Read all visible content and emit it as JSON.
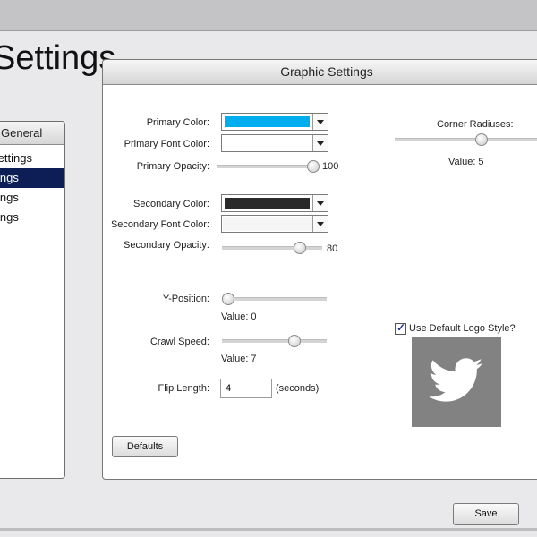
{
  "window": {
    "title": "Settings"
  },
  "sidebar": {
    "header": "General",
    "items": [
      {
        "label": "Settings"
      },
      {
        "label": "ings"
      },
      {
        "label": "ings"
      },
      {
        "label": "ings"
      }
    ]
  },
  "panel": {
    "title": "Graphic Settings",
    "primary_color": {
      "label": "Primary Color:",
      "value": "#00aef0"
    },
    "primary_font_color": {
      "label": "Primary Font Color:",
      "value": "#ffffff"
    },
    "primary_opacity": {
      "label": "Primary Opacity:",
      "value": "100",
      "fraction": 1.0
    },
    "secondary_color": {
      "label": "Secondary Color:",
      "value": "#2a2a2a"
    },
    "secondary_font_color": {
      "label": "Secondary Font Color:",
      "value": "#f5f5f5"
    },
    "secondary_opacity": {
      "label": "Secondary Opacity:",
      "value": "80",
      "fraction": 0.8
    },
    "y_position": {
      "label": "Y-Position:",
      "value_text": "Value:  0",
      "fraction": 0.0
    },
    "crawl_speed": {
      "label": "Crawl Speed:",
      "value_text": "Value:  7",
      "fraction": 0.7
    },
    "flip_length": {
      "label": "Flip Length:",
      "value": "4",
      "unit": "(seconds)"
    },
    "corner_radiuses": {
      "label": "Corner Radiuses:",
      "value_text": "Value: 5"
    },
    "use_default_logo": {
      "label": "Use Default Logo Style?",
      "checked": true
    },
    "logo_icon": "twitter-bird-icon",
    "defaults_button": "Defaults"
  },
  "footer": {
    "save_button": "Save"
  }
}
